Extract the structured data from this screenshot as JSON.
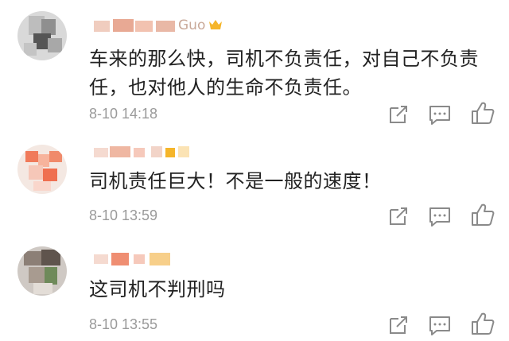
{
  "comments": [
    {
      "username": "Guo",
      "text": "车来的那么快，司机不负责任，对自己不负责任，也对他人的生命不负责任。",
      "time": "8-10 14:18"
    },
    {
      "username": "",
      "text": "司机责任巨大！不是一般的速度！",
      "time": "8-10 13:59"
    },
    {
      "username": "",
      "text": "这司机不判刑吗",
      "time": "8-10 13:55"
    }
  ],
  "icons": {
    "share": "share-icon",
    "reply": "comment-icon",
    "like": "thumbs-up-icon"
  },
  "colors": {
    "text": "#222222",
    "timestamp": "#9a9a9a",
    "icon": "#8a8a8a",
    "username_blur": "#e8b7a4",
    "badge": "#f5b52a"
  }
}
